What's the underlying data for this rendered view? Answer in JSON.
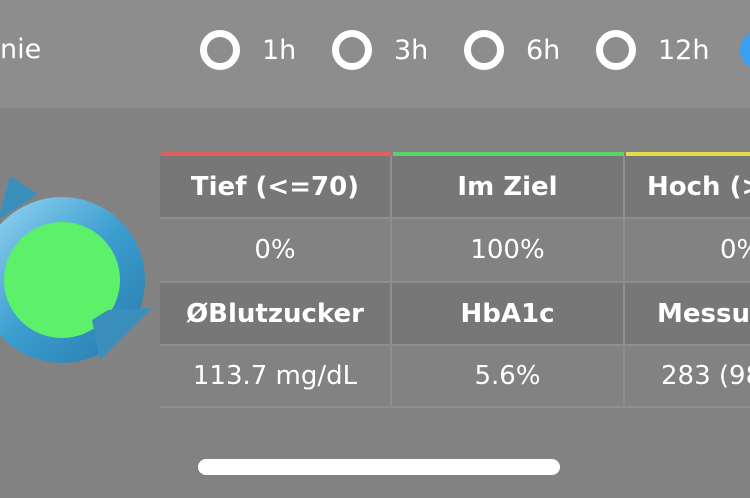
{
  "header": {
    "left_label": "nie",
    "ranges": [
      {
        "label": "1h",
        "selected": false
      },
      {
        "label": "3h",
        "selected": false
      },
      {
        "label": "6h",
        "selected": false
      },
      {
        "label": "12h",
        "selected": false
      },
      {
        "label": "",
        "selected": true
      }
    ]
  },
  "table": {
    "columns": [
      {
        "color": "#e06060"
      },
      {
        "color": "#55d46a"
      },
      {
        "color": "#e6dc4a"
      }
    ],
    "row1_headers": [
      "Tief (<=70)",
      "Im Ziel",
      "Hoch (>"
    ],
    "row1_values": [
      "0%",
      "100%",
      "0%"
    ],
    "row2_headers": [
      "ØBlutzucker",
      "HbA1c",
      "Messu"
    ],
    "row2_values": [
      "113.7 mg/dL",
      "5.6%",
      "283 (98"
    ]
  },
  "colors": {
    "accent": "#3aa0ef",
    "in_range_fill": "#55f06a",
    "logo_ring": "#4aa8d8"
  },
  "icons": {
    "logo": "refresh-cycle-logo-icon"
  }
}
